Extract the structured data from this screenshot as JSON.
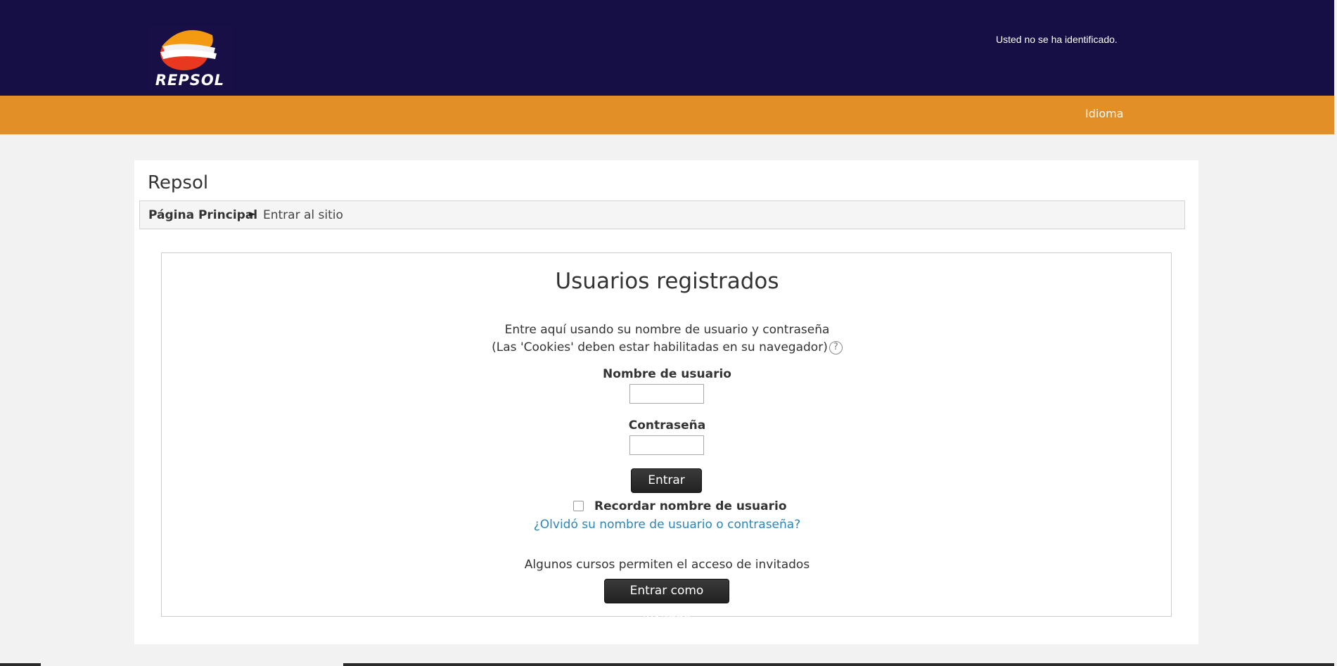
{
  "header": {
    "logo_text": "REPSOL",
    "login_status": "Usted no se ha identificado."
  },
  "navbar": {
    "language_menu": "Idioma"
  },
  "page": {
    "site_title": "Repsol",
    "breadcrumb": {
      "home": "Página Principal",
      "separator": "►",
      "current": "Entrar al sitio"
    }
  },
  "login": {
    "heading": "Usuarios registrados",
    "intro_line1": "Entre aquí usando su nombre de usuario y contraseña",
    "intro_line2": "(Las 'Cookies' deben estar habilitadas en su navegador)",
    "help_icon": "question-mark-icon",
    "username_label": "Nombre de usuario",
    "username_value": "",
    "password_label": "Contraseña",
    "password_value": "",
    "submit_label": "Entrar",
    "remember_label": "Recordar nombre de usuario",
    "remember_checked": false,
    "forgot_link": "¿Olvidó su nombre de usuario o contraseña?",
    "guest_note": "Algunos cursos permiten el acceso de invitados",
    "guest_button": "Entrar como invitado"
  },
  "colors": {
    "header_bg": "#160f45",
    "navbar_bg": "#e38f28",
    "link": "#2a86bd",
    "button_bg": "#2b2b2b"
  }
}
